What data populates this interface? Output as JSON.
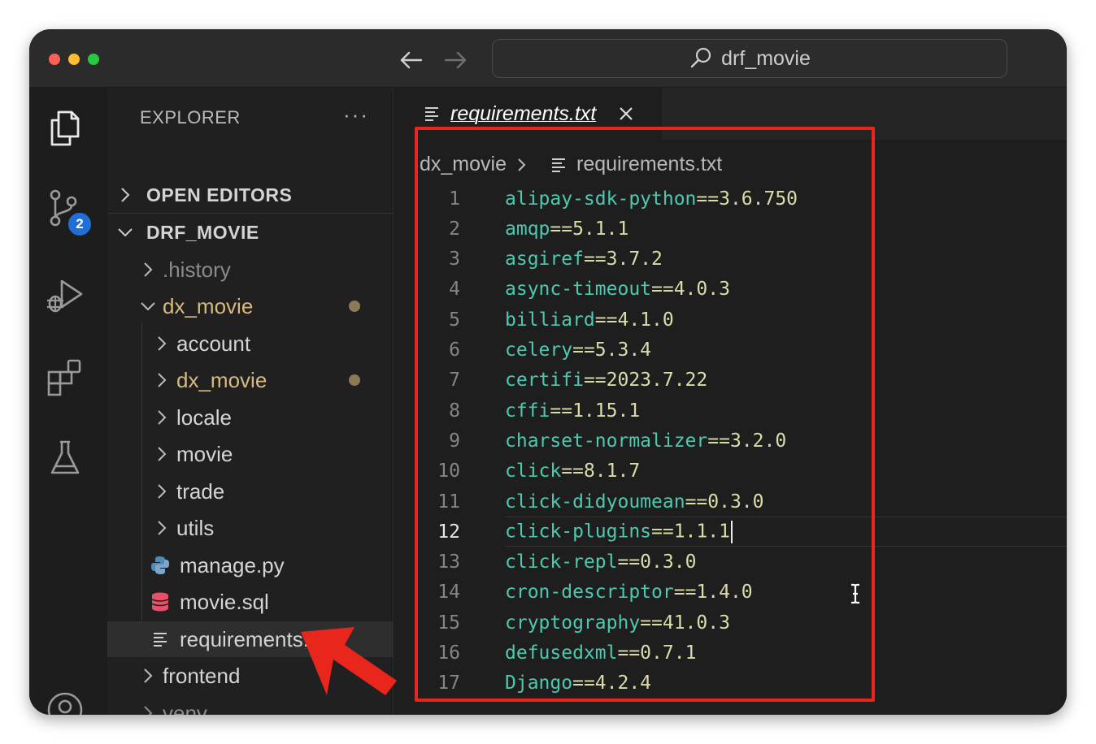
{
  "window": {
    "search_text": "drf_movie"
  },
  "activity_bar": {
    "source_control_badge": "2",
    "icons": [
      "explorer-icon",
      "source-control-icon",
      "run-debug-icon",
      "extensions-icon",
      "testing-icon",
      "accounts-icon"
    ]
  },
  "explorer": {
    "header": "EXPLORER",
    "more": "···",
    "open_editors": "OPEN EDITORS",
    "project": "DRF_MOVIE",
    "tree": [
      {
        "label": ".history",
        "kind": "folder",
        "state": "collapsed"
      },
      {
        "label": "dx_movie",
        "kind": "folder",
        "state": "expanded",
        "modified": true
      },
      {
        "label": "account",
        "kind": "folder",
        "state": "collapsed"
      },
      {
        "label": "dx_movie",
        "kind": "folder",
        "state": "collapsed",
        "modified": true
      },
      {
        "label": "locale",
        "kind": "folder",
        "state": "collapsed"
      },
      {
        "label": "movie",
        "kind": "folder",
        "state": "collapsed"
      },
      {
        "label": "trade",
        "kind": "folder",
        "state": "collapsed"
      },
      {
        "label": "utils",
        "kind": "folder",
        "state": "collapsed"
      },
      {
        "label": "manage.py",
        "kind": "file",
        "icon": "python-icon"
      },
      {
        "label": "movie.sql",
        "kind": "file",
        "icon": "database-icon"
      },
      {
        "label": "requirements.txt",
        "kind": "file",
        "icon": "text-file-icon",
        "selected": true
      },
      {
        "label": "frontend",
        "kind": "folder",
        "state": "collapsed"
      },
      {
        "label": "venv",
        "kind": "folder",
        "state": "collapsed"
      }
    ]
  },
  "editor": {
    "tab_label": "requirements.txt",
    "breadcrumb": {
      "folder": "dx_movie",
      "file": "requirements.txt"
    },
    "active_line": 12,
    "lines": [
      {
        "no": "1",
        "pkg": "alipay-sdk-python",
        "ver": "==3.6.750"
      },
      {
        "no": "2",
        "pkg": "amqp",
        "ver": "==5.1.1"
      },
      {
        "no": "3",
        "pkg": "asgiref",
        "ver": "==3.7.2"
      },
      {
        "no": "4",
        "pkg": "async-timeout",
        "ver": "==4.0.3"
      },
      {
        "no": "5",
        "pkg": "billiard",
        "ver": "==4.1.0"
      },
      {
        "no": "6",
        "pkg": "celery",
        "ver": "==5.3.4"
      },
      {
        "no": "7",
        "pkg": "certifi",
        "ver": "==2023.7.22"
      },
      {
        "no": "8",
        "pkg": "cffi",
        "ver": "==1.15.1"
      },
      {
        "no": "9",
        "pkg": "charset-normalizer",
        "ver": "==3.2.0"
      },
      {
        "no": "10",
        "pkg": "click",
        "ver": "==8.1.7"
      },
      {
        "no": "11",
        "pkg": "click-didyoumean",
        "ver": "==0.3.0"
      },
      {
        "no": "12",
        "pkg": "click-plugins",
        "ver": "==1.1.1"
      },
      {
        "no": "13",
        "pkg": "click-repl",
        "ver": "==0.3.0"
      },
      {
        "no": "14",
        "pkg": "cron-descriptor",
        "ver": "==1.4.0"
      },
      {
        "no": "15",
        "pkg": "cryptography",
        "ver": "==41.0.3"
      },
      {
        "no": "16",
        "pkg": "defusedxml",
        "ver": "==0.7.1"
      },
      {
        "no": "17",
        "pkg": "Django",
        "ver": "==4.2.4"
      }
    ]
  },
  "colors": {
    "annotation_red": "#e8261c",
    "package_name": "#4ec9b0",
    "version": "#dcdcaa",
    "modified_folder": "#d7ba7d",
    "badge_blue": "#1f6fd6"
  }
}
